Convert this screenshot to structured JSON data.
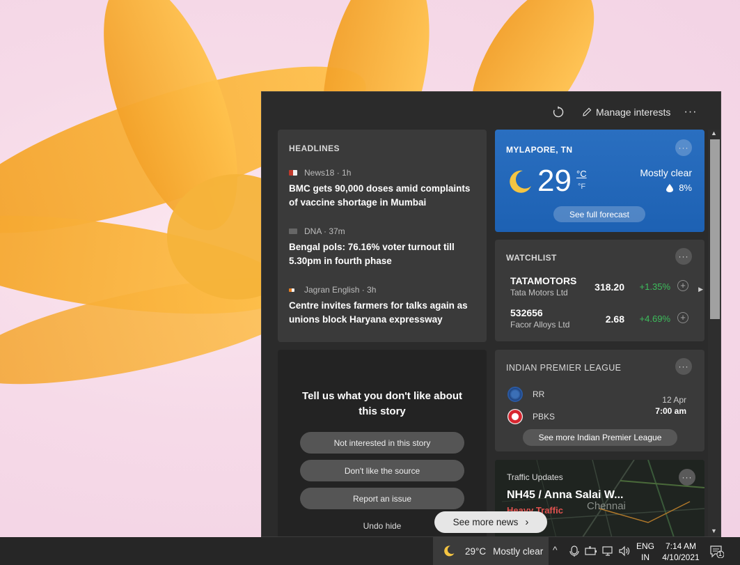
{
  "header": {
    "manage_interests": "Manage interests",
    "more": "···"
  },
  "headlines": {
    "title": "HEADLINES",
    "items": [
      {
        "source": "News18 · 1h",
        "title": "BMC gets 90,000 doses amid complaints of vaccine shortage in Mumbai"
      },
      {
        "source": "DNA · 37m",
        "title": "Bengal pols: 76.16% voter turnout till 5.30pm in fourth phase"
      },
      {
        "source": "Jagran English · 3h",
        "title": "Centre invites farmers for talks again as unions block Haryana expressway"
      }
    ]
  },
  "feedback": {
    "title": "Tell us what you don't like about this story",
    "buttons": [
      "Not interested in this story",
      "Don't like the source",
      "Report an issue"
    ],
    "undo": "Undo hide"
  },
  "weather": {
    "location": "MYLAPORE, TN",
    "temp": "29",
    "unit_c": "°C",
    "unit_f": "°F",
    "condition": "Mostly clear",
    "precip": "8%",
    "forecast_btn": "See full forecast",
    "icon": "moon-icon"
  },
  "watchlist": {
    "title": "WATCHLIST",
    "stocks": [
      {
        "symbol": "TATAMOTORS",
        "name": "Tata Motors Ltd",
        "price": "318.20",
        "change": "+1.35%"
      },
      {
        "symbol": "532656",
        "name": "Facor Alloys Ltd",
        "price": "2.68",
        "change": "+4.69%"
      }
    ]
  },
  "ipl": {
    "title": "INDIAN PREMIER LEAGUE",
    "team1": "RR",
    "team2": "PBKS",
    "date": "12 Apr",
    "time": "7:00 am",
    "more": "See more Indian Premier League"
  },
  "traffic": {
    "title": "Traffic Updates",
    "road": "NH45 / Anna Salai W...",
    "status": "Heavy Traffic",
    "map_label": "Chennai"
  },
  "see_more_news": "See more news",
  "taskbar": {
    "weather_temp": "29°C",
    "weather_cond": "Mostly clear",
    "lang1": "ENG",
    "lang2": "IN",
    "time": "7:14 AM",
    "date": "4/10/2021",
    "notifications": "1"
  },
  "colors": {
    "positive": "#3dbd5c",
    "weather_card": "#1d61b3",
    "traffic_heavy": "#e0524f"
  }
}
